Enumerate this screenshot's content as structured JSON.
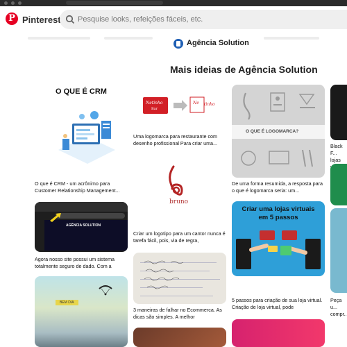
{
  "app": {
    "brand": "Pinterest"
  },
  "search": {
    "placeholder": "Pesquise looks, refeições fáceis, etc."
  },
  "profile": {
    "name": "Agência Solution"
  },
  "section": {
    "title": "Mais ideias de Agência Solution"
  },
  "colors": {
    "brand_red": "#e60023",
    "search_bg": "#efefef"
  },
  "pins": {
    "crm": {
      "card_title": "O QUE É CRM",
      "caption": "O que é CRM - um acrônimo para Customer Relationship Management..."
    },
    "site": {
      "screen_title": "AGÊNCIA SOLUTION",
      "caption": "Agora nosso site possui um sistema totalmente seguro de dado. Com a"
    },
    "sky": {
      "tag": "BEM DIA",
      "caption": ""
    },
    "logo_restaurant": {
      "caption": "Uma logomarca para restaurante com desenho profissional Para criar uma..."
    },
    "logo_singer": {
      "image_text": "bruno",
      "caption": "Criar um logotipo para um cantor nunca é tarefa fácil, pois, via de regra,"
    },
    "ecommerce": {
      "caption": "3 maneiras de falhar no Ecommerca. As dicas são simples. A melhor"
    },
    "logomarca": {
      "band_text": "O QUE É LOGOMARCA?",
      "caption": "De uma forma resumida, a resposta para o que é logomarca seria: um..."
    },
    "loja": {
      "card_title": "Criar uma lojas virtuais em 5 passos",
      "caption": "5 passos para criação de sua loja virtual. Criação de loja virtual, pode"
    },
    "col4_top": {
      "caption": "Black F... lojas v..."
    },
    "col4_bottom": {
      "caption": "Peça u... compr..."
    }
  }
}
